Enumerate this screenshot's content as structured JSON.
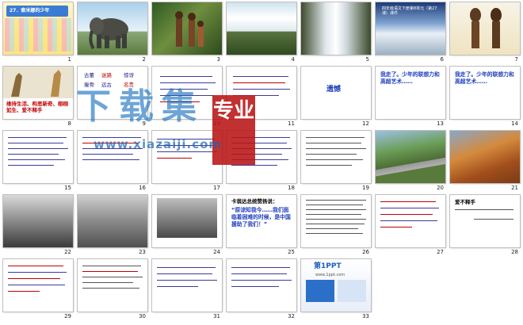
{
  "slides": [
    {
      "number": "1",
      "title": "27．索米娜的少年"
    },
    {
      "number": "2"
    },
    {
      "number": "3"
    },
    {
      "number": "4"
    },
    {
      "number": "5"
    },
    {
      "number": "6",
      "caption": "四年级语文下册第8单元（第27课）课件"
    },
    {
      "number": "7"
    },
    {
      "number": "8",
      "caption": "维持生活、构思新奇、栩栩如生、爱不释手"
    },
    {
      "number": "9",
      "lines": [
        "古董",
        "迷路",
        "惊讶",
        "瘦骨",
        "远古",
        "名贵",
        "雕刻",
        "精湛",
        "运气",
        "扎实",
        "手艺",
        "地道",
        "骄傲"
      ]
    },
    {
      "number": "10"
    },
    {
      "number": "11"
    },
    {
      "number": "12",
      "text": "遗憾"
    },
    {
      "number": "13",
      "text": "我走了。少年的联想力和高超艺术……"
    },
    {
      "number": "14",
      "text": "我走了。少年的联想力和高超艺术……"
    },
    {
      "number": "15"
    },
    {
      "number": "16"
    },
    {
      "number": "17"
    },
    {
      "number": "18"
    },
    {
      "number": "19"
    },
    {
      "number": "20"
    },
    {
      "number": "21"
    },
    {
      "number": "22"
    },
    {
      "number": "23"
    },
    {
      "number": "24"
    },
    {
      "number": "25",
      "title": "卡翁达总统赞扬说：",
      "quote": "“原谅知我今……我们面临着困难的时候，是中国援助了我们！”"
    },
    {
      "number": "26"
    },
    {
      "number": "27"
    },
    {
      "number": "28",
      "title": "爱不释手"
    },
    {
      "number": "29"
    },
    {
      "number": "30"
    },
    {
      "number": "31"
    },
    {
      "number": "32"
    },
    {
      "number": "33",
      "logo": "第1PPT",
      "site": "www.1ppt.com"
    }
  ],
  "watermark": {
    "title": "下载集",
    "badge": "专业",
    "url": "www.xiazaiji.com"
  },
  "colors": {
    "text_blue": "#1a1a8c",
    "accent_red": "#c00000",
    "watermark_blue": "#146ebe",
    "badge_red": "#b91414"
  }
}
